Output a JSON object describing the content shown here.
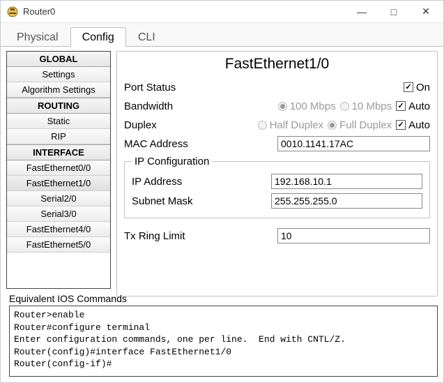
{
  "window": {
    "title": "Router0"
  },
  "tabs": {
    "physical": "Physical",
    "config": "Config",
    "cli": "CLI",
    "active": "config"
  },
  "sidebar": {
    "global_header": "GLOBAL",
    "global": [
      {
        "label": "Settings"
      },
      {
        "label": "Algorithm Settings"
      }
    ],
    "routing_header": "ROUTING",
    "routing": [
      {
        "label": "Static"
      },
      {
        "label": "RIP"
      }
    ],
    "interface_header": "INTERFACE",
    "interfaces": [
      {
        "label": "FastEthernet0/0"
      },
      {
        "label": "FastEthernet1/0"
      },
      {
        "label": "Serial2/0"
      },
      {
        "label": "Serial3/0"
      },
      {
        "label": "FastEthernet4/0"
      },
      {
        "label": "FastEthernet5/0"
      }
    ],
    "selected": "FastEthernet1/0"
  },
  "main": {
    "title": "FastEthernet1/0",
    "port_status": {
      "label": "Port Status",
      "on_label": "On",
      "checked": true
    },
    "bandwidth": {
      "label": "Bandwidth",
      "o100": "100 Mbps",
      "o10": "10 Mbps",
      "selected": "100",
      "auto_label": "Auto",
      "auto_checked": true
    },
    "duplex": {
      "label": "Duplex",
      "half": "Half Duplex",
      "full": "Full Duplex",
      "selected": "full",
      "auto_label": "Auto",
      "auto_checked": true
    },
    "mac": {
      "label": "MAC Address",
      "value": "0010.1141.17AC"
    },
    "ipconf": {
      "legend": "IP Configuration",
      "ip_label": "IP Address",
      "ip_value": "192.168.10.1",
      "mask_label": "Subnet Mask",
      "mask_value": "255.255.255.0"
    },
    "txring": {
      "label": "Tx Ring Limit",
      "value": "10"
    }
  },
  "equivalent_label": "Equivalent IOS Commands",
  "console_lines": [
    "Router>enable",
    "Router#configure terminal",
    "Enter configuration commands, one per line.  End with CNTL/Z.",
    "Router(config)#interface FastEthernet1/0",
    "Router(config-if)#"
  ]
}
